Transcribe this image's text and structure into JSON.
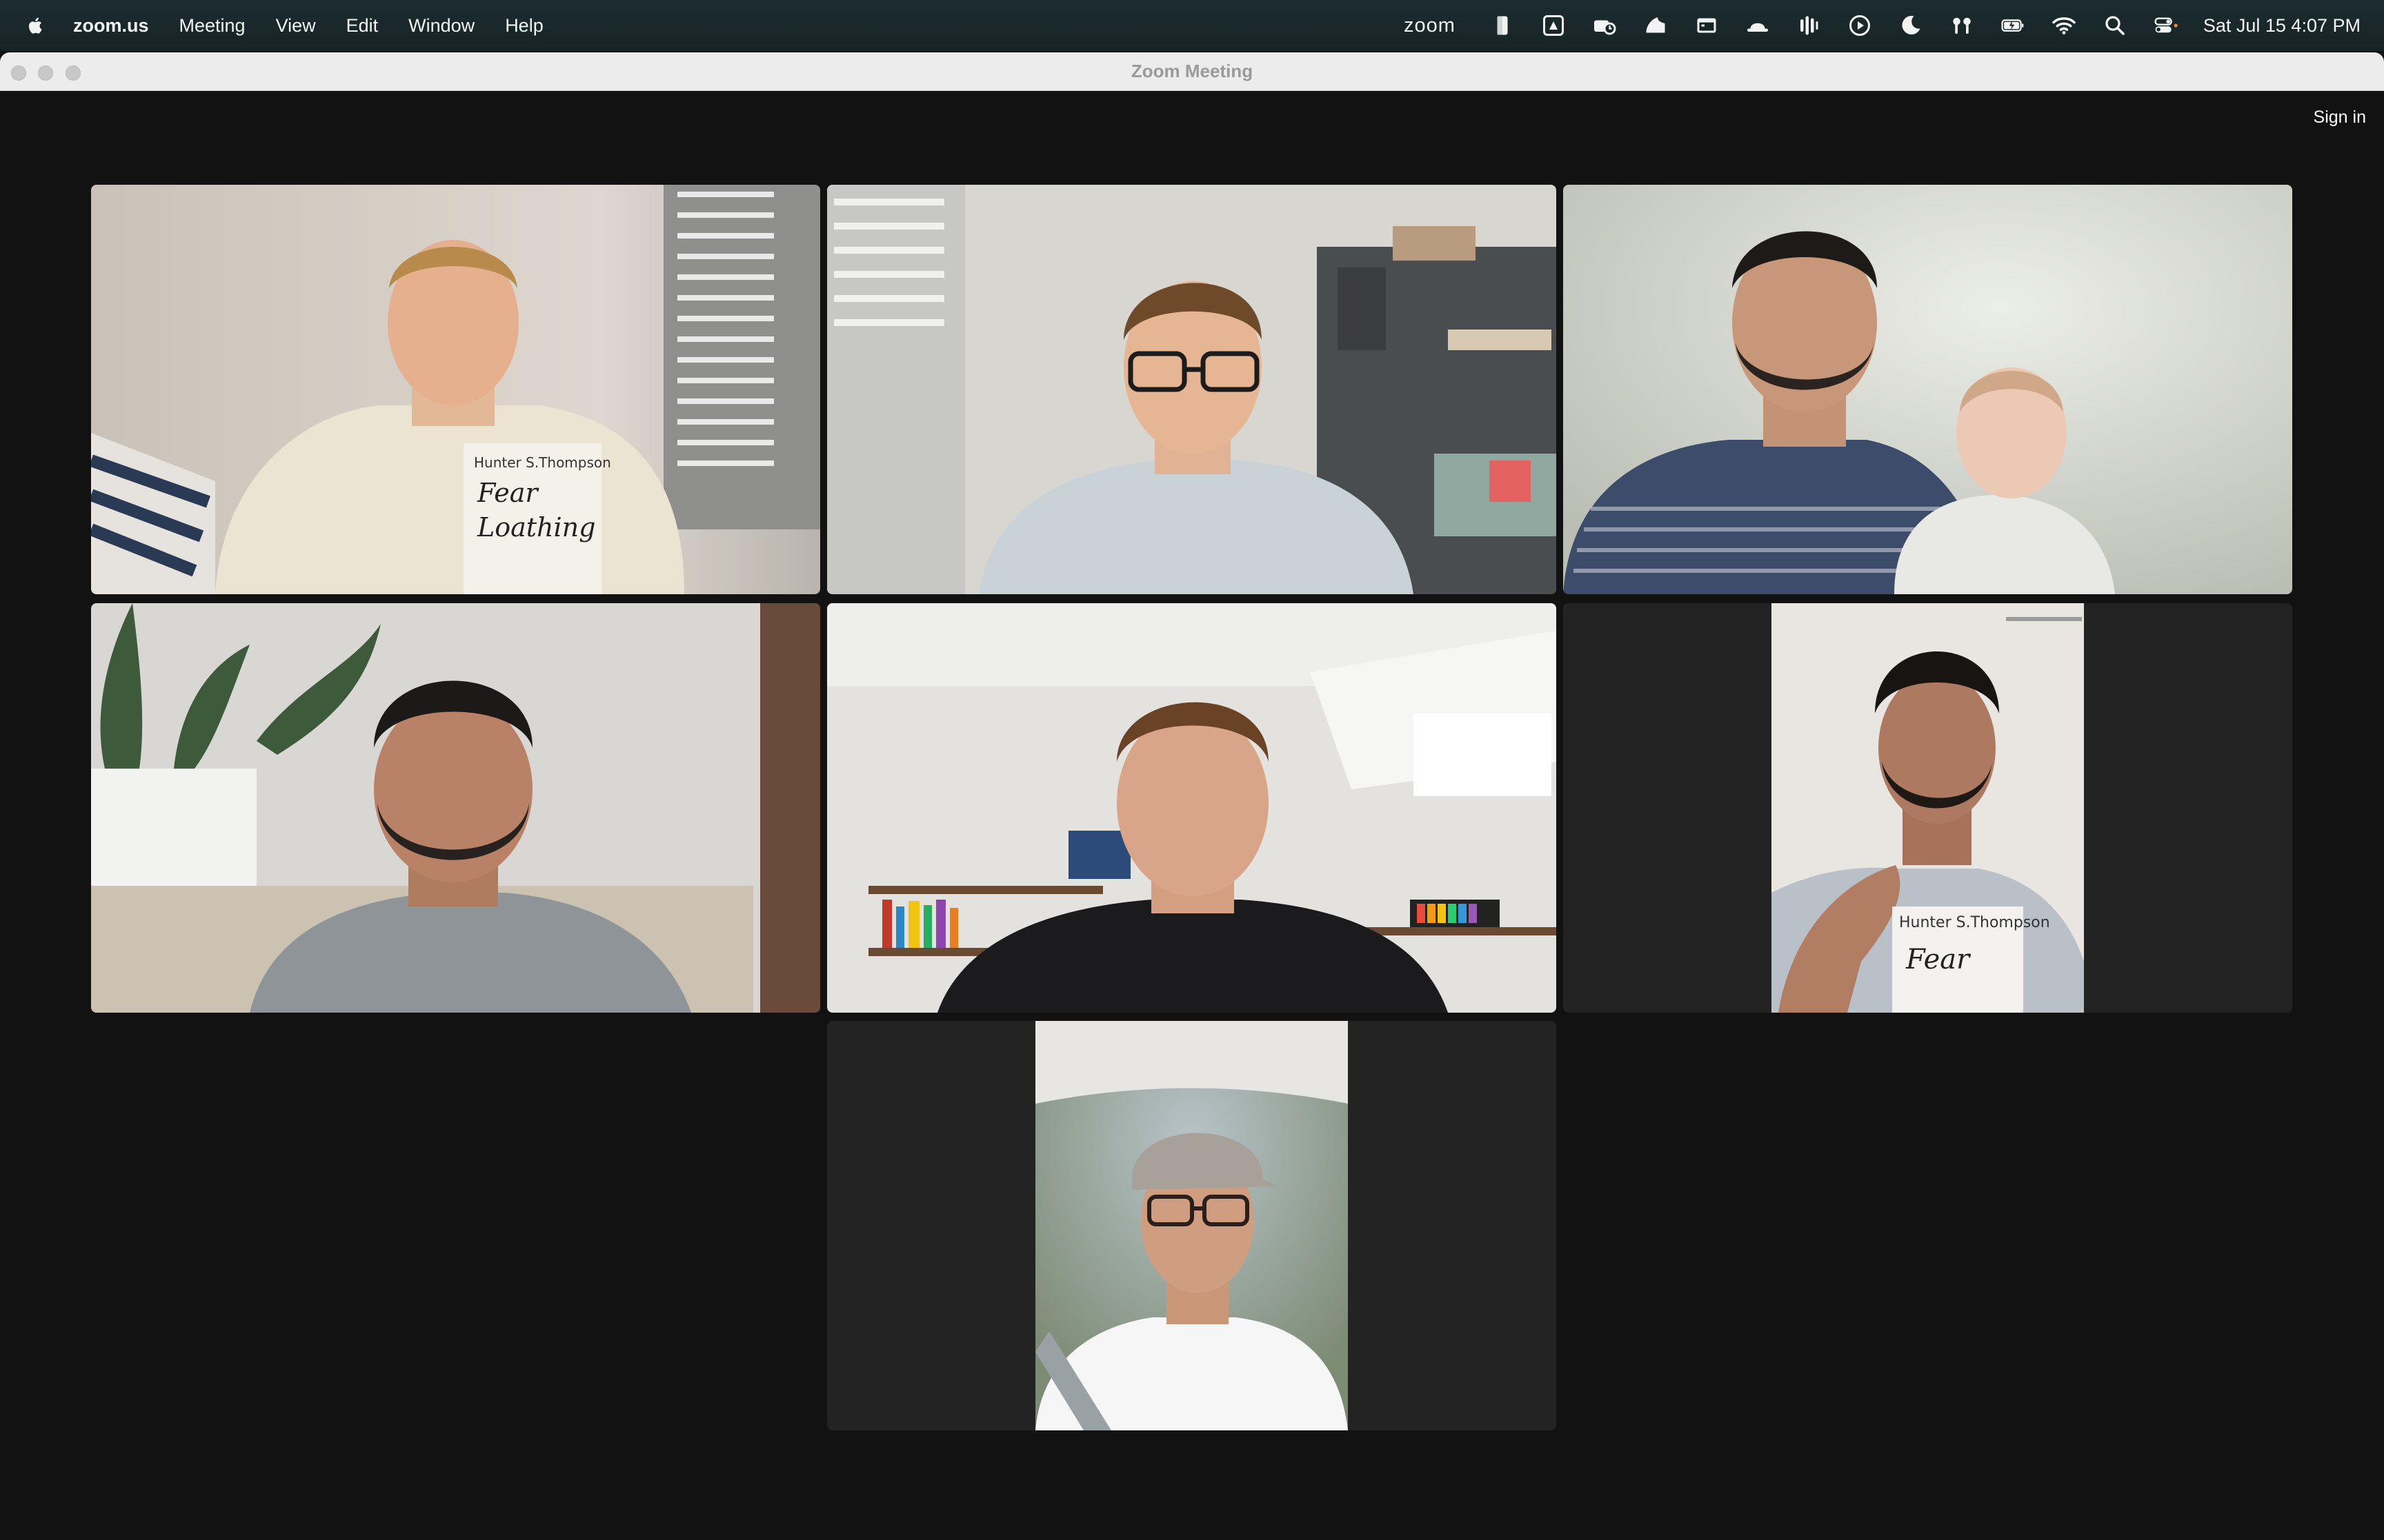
{
  "menubar": {
    "app_name": "zoom.us",
    "menus": [
      "Meeting",
      "View",
      "Edit",
      "Window",
      "Help"
    ],
    "zoom_logo": "zoom",
    "datetime": "Sat Jul 15  4:07 PM",
    "status_icons": [
      "phone-icon",
      "drive-icon",
      "camera-icon",
      "creative-cloud-icon",
      "screen-icon",
      "hat-icon",
      "audio-icon",
      "play-icon",
      "moon-icon",
      "airpods-icon",
      "battery-icon",
      "wifi-icon",
      "search-icon",
      "control-center-icon"
    ]
  },
  "window": {
    "title": "Zoom Meeting",
    "sign_in_label": "Sign in"
  },
  "meeting": {
    "participant_count": 7,
    "active_speaker": 2,
    "participants": [
      {
        "book_author": "Hunter S.Thompson",
        "book_title": "Fear and Loathing in Las Vegas"
      },
      {},
      {},
      {},
      {},
      {
        "book_author": "Hunter S.Thompson",
        "book_title": "Fear and Loathing"
      },
      {}
    ]
  },
  "colors": {
    "background": "#121212",
    "tile": "#232323",
    "active_border": "#22d036",
    "menubar": "#1b2a2c"
  }
}
